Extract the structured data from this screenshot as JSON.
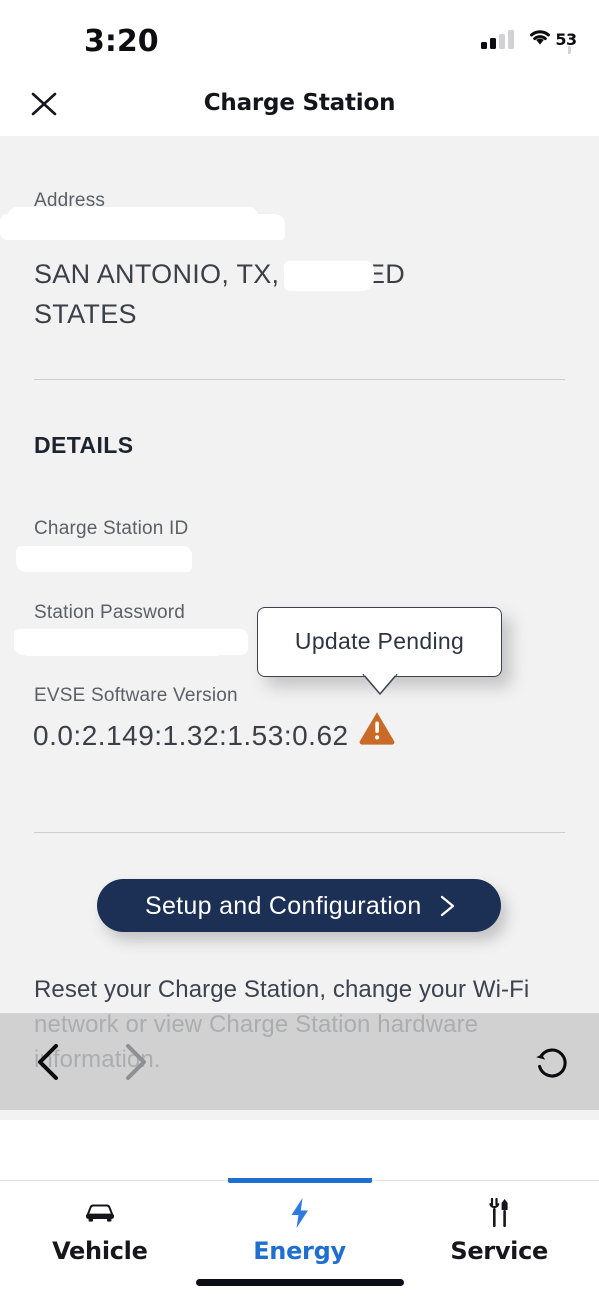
{
  "status_bar": {
    "time": "3:20",
    "signal_icon": "cellular-signal-icon",
    "signal_bars_filled": 2,
    "signal_bars_total": 4,
    "wifi_icon": "wifi-icon",
    "battery_icon": "battery-icon",
    "battery_level": "53",
    "battery_percent": 53,
    "battery_low_power_mode": true,
    "battery_color": "#f8d117"
  },
  "header": {
    "title": "Charge Station",
    "close_icon": "close-icon"
  },
  "content": {
    "address": {
      "label": "Address",
      "value": "SAN ANTONIO, TX,        , UNITED STATES",
      "street_redacted": true,
      "zip_redacted": true
    },
    "details_heading": "DETAILS",
    "fields": [
      {
        "label": "Charge Station ID",
        "value": "",
        "redacted": true
      },
      {
        "label": "Station Password",
        "value": "",
        "redacted": true
      },
      {
        "label": "EVSE Software Version",
        "value": "0.0:2.149:1.32:1.53:0.62",
        "redacted": false
      }
    ],
    "warning": {
      "icon": "warning-triangle-icon",
      "color": "#c96a28",
      "tooltip_text": "Update Pending"
    },
    "cta": {
      "label": "Setup and Configuration",
      "chevron_icon": "chevron-right-icon",
      "background_color": "#1b3054",
      "description": "Reset your Charge Station, change your Wi-Fi network or view Charge Station hardware information."
    }
  },
  "browser_nav": {
    "back_icon": "chevron-left-icon",
    "back_enabled": true,
    "forward_icon": "chevron-right-icon",
    "forward_enabled": false,
    "reload_icon": "reload-icon"
  },
  "tab_bar": {
    "active_index": 1,
    "accent_color": "#1f6fd0",
    "tabs": [
      {
        "label": "Vehicle",
        "icon": "car-icon"
      },
      {
        "label": "Energy",
        "icon": "lightning-bolt-icon"
      },
      {
        "label": "Service",
        "icon": "wrench-screwdriver-icon"
      }
    ]
  }
}
